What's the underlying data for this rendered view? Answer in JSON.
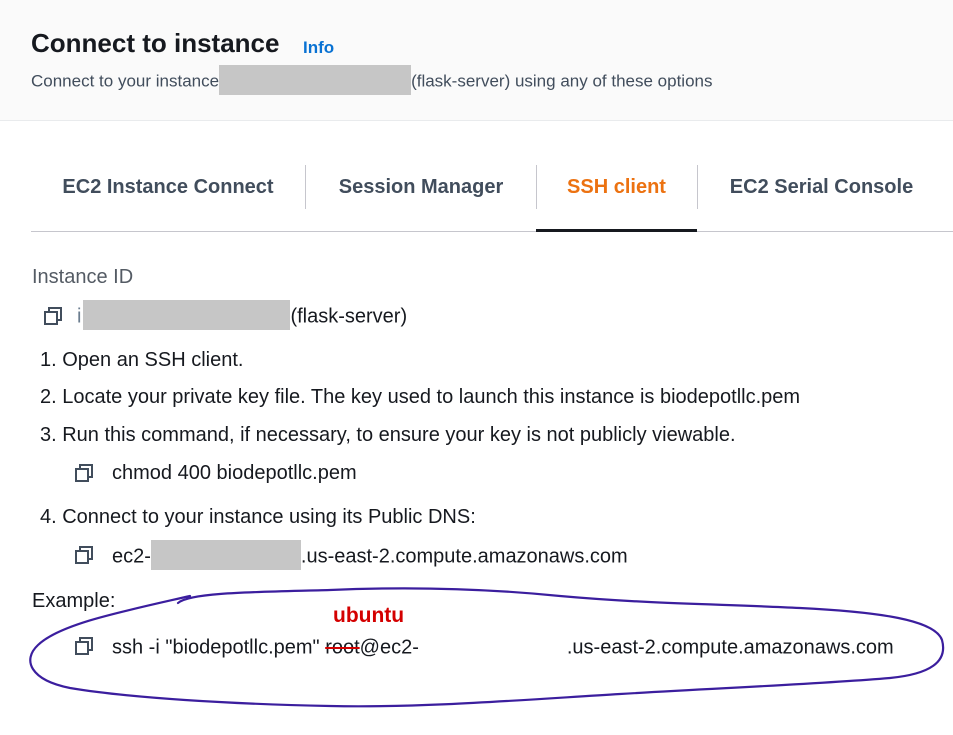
{
  "header": {
    "title": "Connect to instance",
    "info_link": "Info",
    "subtitle_prefix": "Connect to your instance",
    "subtitle_suffix": "(flask-server) using any of these options"
  },
  "tabs": [
    {
      "label": "EC2 Instance Connect"
    },
    {
      "label": "Session Manager"
    },
    {
      "label": "SSH client"
    },
    {
      "label": "EC2 Serial Console"
    }
  ],
  "active_tab": "SSH client",
  "instance": {
    "label": "Instance ID",
    "id_prefix": "i",
    "name_suffix": "(flask-server)"
  },
  "steps": {
    "step1": "1. Open an SSH client.",
    "step2": "2. Locate your private key file. The key used to launch this instance is biodepotllc.pem",
    "step3": "3. Run this command, if necessary, to ensure your key is not publicly viewable.",
    "chmod_command": "chmod 400 biodepotllc.pem",
    "step4": "4. Connect to your instance using its Public DNS:",
    "dns_prefix": "ec2-",
    "dns_suffix": ".us-east-2.compute.amazonaws.com"
  },
  "example": {
    "label": "Example:",
    "cmd_prefix": "ssh -i \"biodepotllc.pem\" ",
    "cmd_user": "root",
    "cmd_host_prefix": "@ec2-",
    "cmd_suffix": ".us-east-2.compute.amazonaws.com",
    "annotation": "ubuntu"
  },
  "colors": {
    "active_tab": "#ec7211",
    "link": "#0972d3",
    "annotation": "#d40000",
    "ellipse": "#3b1e9e"
  }
}
